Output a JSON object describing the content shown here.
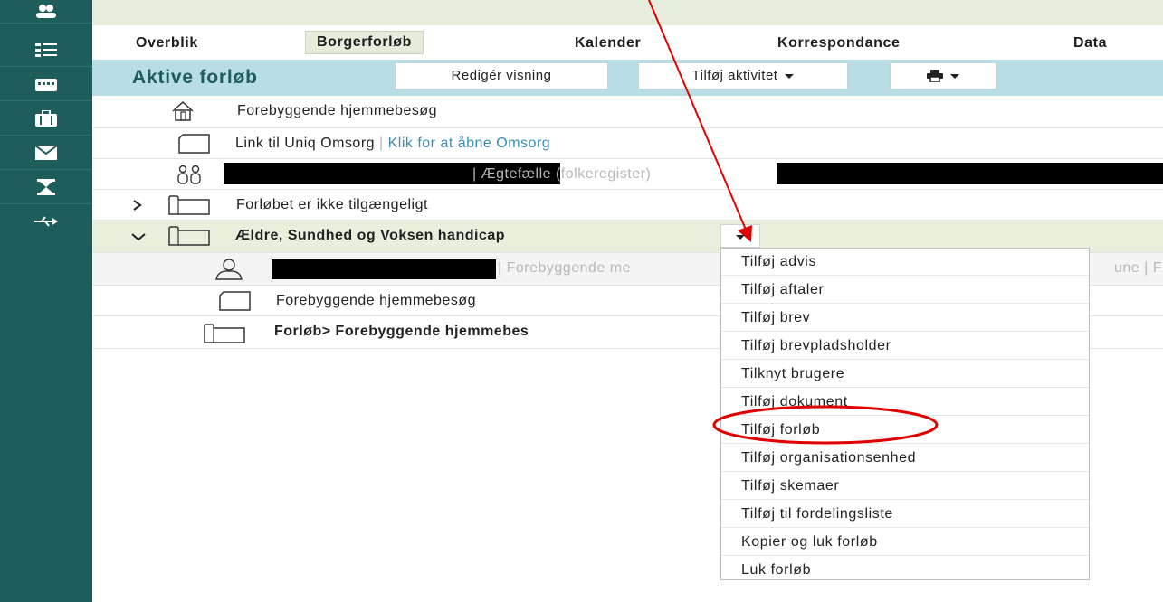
{
  "sidebar": {
    "icons": [
      "people-icon",
      "list-icon",
      "calendar-icon",
      "briefcase-icon",
      "mail-icon",
      "hourglass-icon",
      "usb-icon"
    ]
  },
  "nav": {
    "tabs": [
      {
        "label": "Overblik"
      },
      {
        "label": "Borgerforløb"
      },
      {
        "label": "Kalender"
      },
      {
        "label": "Korrespondance"
      },
      {
        "label": "Data"
      }
    ]
  },
  "toolbar": {
    "title": "Aktive forløb",
    "edit_view": "Redigér visning",
    "add_activity": "Tilføj aktivitet"
  },
  "tree": {
    "home_visit": "Forebyggende hjemmebesøg",
    "link_text": "Link til Uniq Omsorg",
    "link_sep": " | ",
    "link_action": "Klik for at åbne Omsorg",
    "spouse_label": "| Ægtefælle (folkeregister)",
    "unavailable": "Forløbet er ikke tilgængeligt",
    "category": "Ældre, Sundhed og Voksen handicap",
    "child_person_suffix": "| Forebyggende me",
    "child_person_tail": "une | F",
    "child_home_visit": "Forebyggende hjemmebesøg",
    "child_course": "Forløb> Forebyggende hjemmebes"
  },
  "menu": {
    "items": [
      "Tilføj advis",
      "Tilføj aftaler",
      "Tilføj brev",
      "Tilføj brevpladsholder",
      "Tilknyt brugere",
      "Tilføj dokument",
      "Tilføj forløb",
      "Tilføj organisationsenhed",
      "Tilføj skemaer",
      "Tilføj til fordelingsliste",
      "Kopier og luk forløb",
      "Luk forløb"
    ],
    "highlighted_item": "Tilføj forløb"
  },
  "colors": {
    "sidebar": "#1e5d5c",
    "toolbar": "#b9dde4",
    "annotation": "#e00000"
  }
}
